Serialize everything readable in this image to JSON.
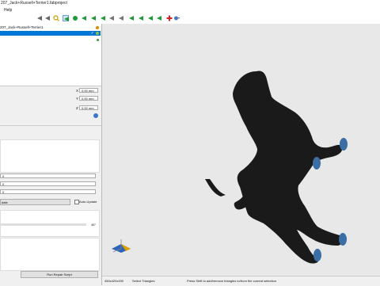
{
  "window": {
    "title": "207_Jack+Russell+Terrier1.fabproject"
  },
  "menu": {
    "help": "Help"
  },
  "tree": {
    "item1": "207_Jack+Russell+Terrier1",
    "item2": ""
  },
  "transform": {
    "x_value": "0.00 mm",
    "y_value": "0.00 mm",
    "z_value": "0.00 mm",
    "x_label": "X",
    "y_label": "Y",
    "z_label": "Z"
  },
  "fields": {
    "f1": "0",
    "f2": "0",
    "f3": "0"
  },
  "update_button": "date",
  "auto_update": "Auto-Update",
  "angle_value": "45°",
  "run_repair_script": "Run Repair Script",
  "status": {
    "dims": "450x420x490",
    "mode": "Select Triangles",
    "hint": "Press Shift to add/remove triangles to/from the current selection"
  },
  "colors": {
    "selection": "#0078d7",
    "model": "#1a1a1a",
    "paw": "#3a6ea5"
  }
}
